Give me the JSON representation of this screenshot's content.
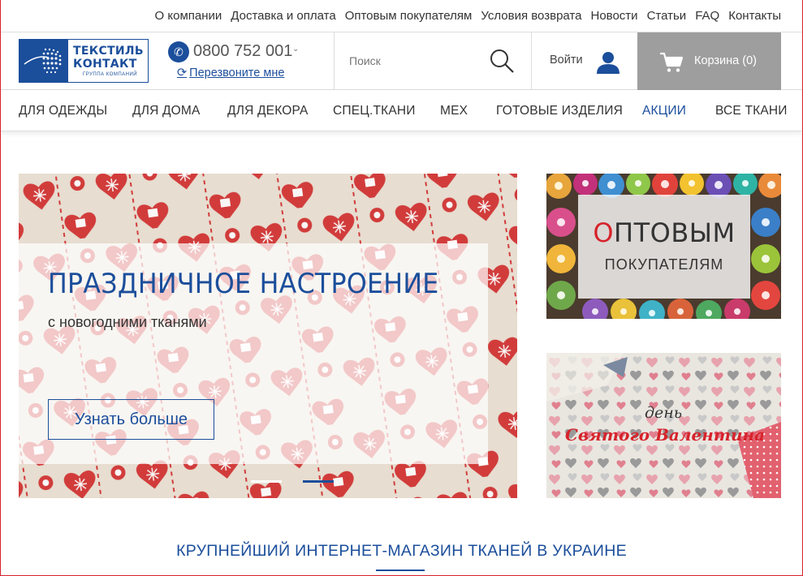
{
  "top_links": [
    "О компании",
    "Доставка и оплата",
    "Оптовым покупателям",
    "Условия возврата",
    "Новости",
    "Статьи",
    "FAQ",
    "Контакты"
  ],
  "logo": {
    "line1": "ТЕКСТИЛЬ",
    "line2": "КОНТАКТ",
    "line3": "ГРУППА КОМПАНИЙ"
  },
  "phone": {
    "number": "0800 752 001",
    "callback": "Перезвоните мне"
  },
  "search": {
    "placeholder": "Поиск"
  },
  "login_label": "Войти",
  "cart_label": "Корзина (0)",
  "nav": [
    {
      "label": "ДЛЯ ОДЕЖДЫ",
      "active": false
    },
    {
      "label": "ДЛЯ ДОМА",
      "active": false
    },
    {
      "label": "ДЛЯ ДЕКОРА",
      "active": false
    },
    {
      "label": "СПЕЦ.ТКАНИ",
      "active": false
    },
    {
      "label": "МЕХ",
      "active": false
    },
    {
      "label": "ГОТОВЫЕ ИЗДЕЛИЯ",
      "active": false
    },
    {
      "label": "АКЦИИ",
      "active": true
    },
    {
      "label": "ВСЕ ТКАНИ",
      "active": false
    }
  ],
  "hero": {
    "title": "ПРАЗДНИЧНОЕ НАСТРОЕНИЕ",
    "subtitle": "с новогодними тканями",
    "button": "Узнать больше",
    "slides_count": 2,
    "active_slide": 2
  },
  "banner_wholesale": {
    "line1_prefix": "О",
    "line1_rest": "ПТОВЫМ",
    "line2": "ПОКУПАТЕЛЯМ"
  },
  "banner_valentine": {
    "line1": "день",
    "line2": "Святого Валентина"
  },
  "bottom_title": "КРУПНЕЙШИЙ ИНТЕРНЕТ-МАГАЗИН ТКАНЕЙ В УКРАИНЕ",
  "colors": {
    "brand_blue": "#1b4e9b",
    "accent_red": "#d6232b",
    "cart_gray": "#9e9e9e"
  }
}
